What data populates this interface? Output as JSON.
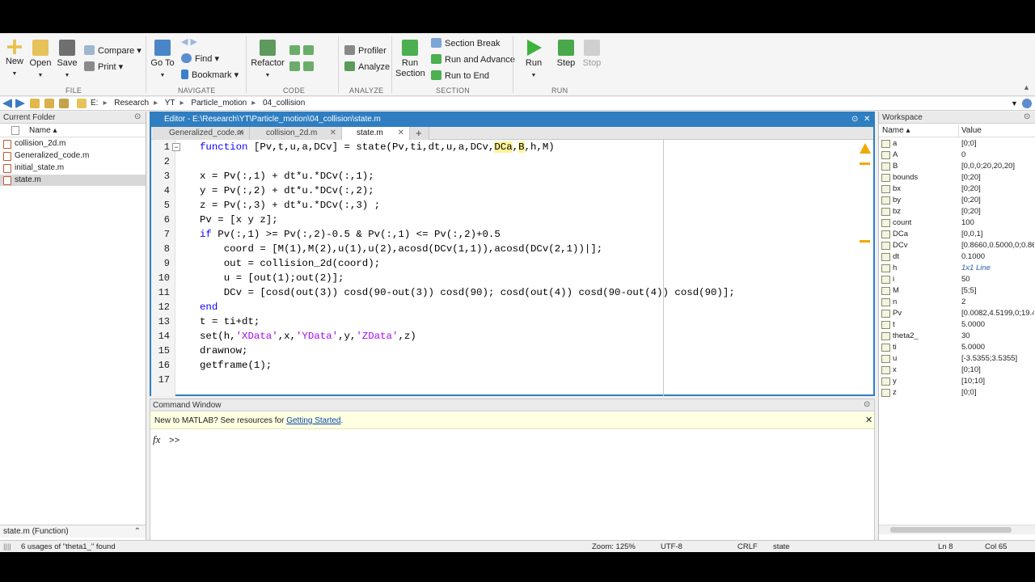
{
  "toolstrip": {
    "file": {
      "new": "New",
      "open": "Open",
      "save": "Save",
      "compare": "Compare",
      "print": "Print",
      "label": "FILE"
    },
    "navigate": {
      "goto": "Go To",
      "find": "Find",
      "bookmark": "Bookmark",
      "label": "NAVIGATE"
    },
    "code": {
      "refactor": "Refactor",
      "label": "CODE"
    },
    "analyze": {
      "profiler": "Profiler",
      "analyze": "Analyze",
      "label": "ANALYZE"
    },
    "section": {
      "run_section": "Run Section",
      "section_break": "Section Break",
      "run_advance": "Run and Advance",
      "run_end": "Run to End",
      "label": "SECTION"
    },
    "run": {
      "run": "Run",
      "step": "Step",
      "stop": "Stop",
      "label": "RUN"
    }
  },
  "address": {
    "crumbs": [
      "E:",
      "Research",
      "YT",
      "Particle_motion",
      "04_collision"
    ]
  },
  "current_folder": {
    "title": "Current Folder",
    "col_name": "Name ▴",
    "files": [
      "collision_2d.m",
      "Generalized_code.m",
      "initial_state.m",
      "state.m"
    ],
    "selected": 3,
    "footer": "state.m  (Function)"
  },
  "editor": {
    "title": "Editor - E:\\Research\\YT\\Particle_motion\\04_collision\\state.m",
    "tabs": [
      "Generalized_code.m",
      "collision_2d.m",
      "state.m"
    ],
    "active_tab": 2,
    "lines": [
      "1",
      "2",
      "3",
      "4",
      "5",
      "6",
      "7",
      "8",
      "9",
      "10",
      "11",
      "12",
      "13",
      "14",
      "15",
      "16",
      "17"
    ]
  },
  "command_window": {
    "title": "Command Window",
    "notice_text": "New to MATLAB? See resources for ",
    "notice_link": "Getting Started",
    "notice_end": ".",
    "fx": "fx",
    "prompt": ">>"
  },
  "workspace": {
    "title": "Workspace",
    "col_name": "Name ▴",
    "col_value": "Value",
    "vars": [
      {
        "name": "a",
        "value": "[0;0]"
      },
      {
        "name": "A",
        "value": "0"
      },
      {
        "name": "B",
        "value": "[0,0,0;20,20,20]"
      },
      {
        "name": "bounds",
        "value": "[0;20]"
      },
      {
        "name": "bx",
        "value": "[0;20]"
      },
      {
        "name": "by",
        "value": "[0;20]"
      },
      {
        "name": "bz",
        "value": "[0;20]"
      },
      {
        "name": "count",
        "value": "100"
      },
      {
        "name": "DCa",
        "value": "[0,0,1]"
      },
      {
        "name": "DCv",
        "value": "[0.8660,0.5000,0;0.86"
      },
      {
        "name": "dt",
        "value": "0.1000"
      },
      {
        "name": "h",
        "value": "1x1 Line"
      },
      {
        "name": "i",
        "value": "50"
      },
      {
        "name": "M",
        "value": "[5;5]"
      },
      {
        "name": "n",
        "value": "2"
      },
      {
        "name": "Pv",
        "value": "[0.0082,4.5199,0;19.4"
      },
      {
        "name": "t",
        "value": "5.0000"
      },
      {
        "name": "theta2_",
        "value": "30"
      },
      {
        "name": "ti",
        "value": "5.0000"
      },
      {
        "name": "u",
        "value": "[-3.5355;3.5355]"
      },
      {
        "name": "x",
        "value": "[0;10]"
      },
      {
        "name": "y",
        "value": "[10;10]"
      },
      {
        "name": "z",
        "value": "[0;0]"
      }
    ]
  },
  "status": {
    "usages": "6 usages of \"theta1_\" found",
    "zoom": "Zoom: 125%",
    "encoding": "UTF-8",
    "eol": "CRLF",
    "func": "state",
    "ln": "Ln  8",
    "col": "Col  65"
  }
}
